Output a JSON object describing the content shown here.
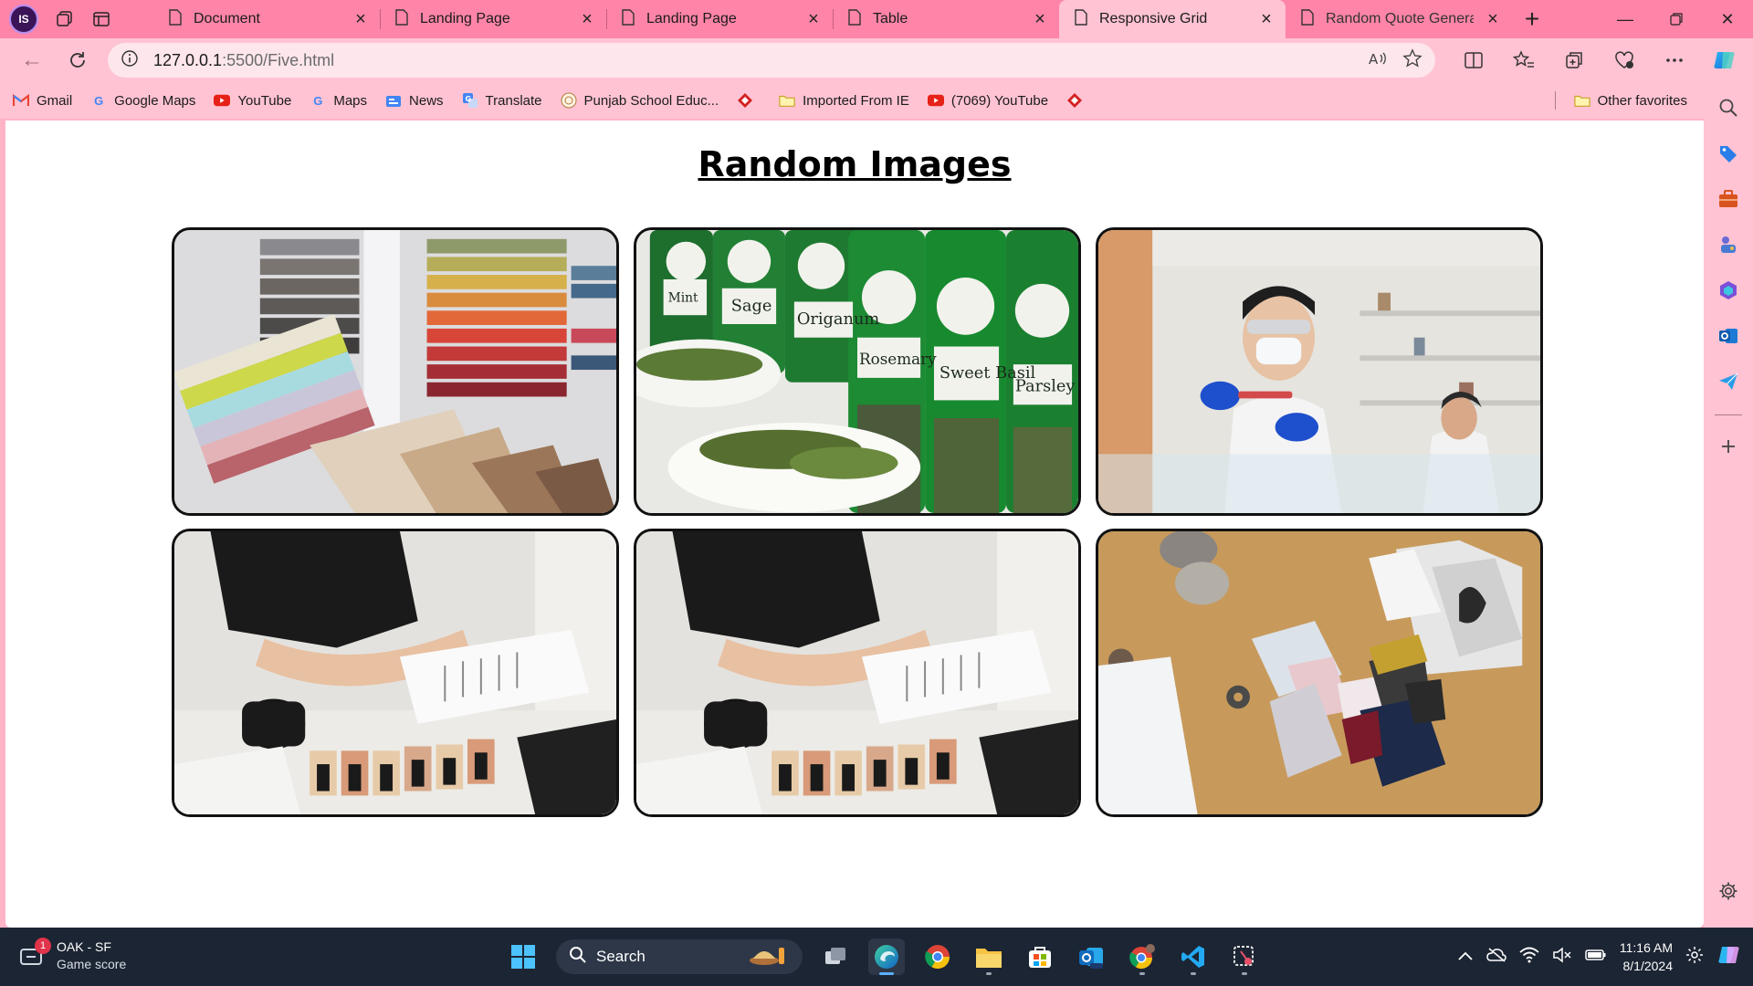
{
  "browser": {
    "profile_initials": "IS",
    "tabs": [
      {
        "title": "Document",
        "active": false
      },
      {
        "title": "Landing Page",
        "active": false
      },
      {
        "title": "Landing Page",
        "active": false
      },
      {
        "title": "Table",
        "active": false
      },
      {
        "title": "Responsive Grid",
        "active": true
      },
      {
        "title": "Random Quote Generato",
        "active": false
      }
    ],
    "address": {
      "host": "127.0.0.1",
      "rest": ":5500/Five.html"
    },
    "bookmarks": [
      {
        "label": "Gmail",
        "icon": "gmail-icon"
      },
      {
        "label": "Google Maps",
        "icon": "google-icon"
      },
      {
        "label": "YouTube",
        "icon": "youtube-icon"
      },
      {
        "label": "Maps",
        "icon": "google-icon"
      },
      {
        "label": "News",
        "icon": "news-icon"
      },
      {
        "label": "Translate",
        "icon": "translate-icon"
      },
      {
        "label": "Punjab School Educ...",
        "icon": "school-icon"
      },
      {
        "label": "",
        "icon": "diamond-icon"
      },
      {
        "label": "Imported From IE",
        "icon": "folder-icon"
      },
      {
        "label": "(7069) YouTube",
        "icon": "youtube-icon"
      },
      {
        "label": "",
        "icon": "diamond-icon"
      }
    ],
    "other_favorites": "Other favorites"
  },
  "page": {
    "title": "Random Images",
    "images": [
      {
        "subject": "fabric and color swatches",
        "icon": "swatches-image"
      },
      {
        "subject": "spice jars with herbs",
        "icon": "spices-image",
        "jar_labels": [
          "Mint",
          "Sage",
          "Origanum",
          "Rosemary",
          "Sweet Basil",
          "Parsley"
        ]
      },
      {
        "subject": "scientist in lab",
        "icon": "lab-image"
      },
      {
        "subject": "person sketching fashion designs",
        "icon": "sketch-image"
      },
      {
        "subject": "person sketching fashion designs",
        "icon": "sketch-image"
      },
      {
        "subject": "fabric samples and photos on table",
        "icon": "fabrics-image"
      }
    ]
  },
  "taskbar": {
    "widget": {
      "line1": "OAK - SF",
      "line2": "Game score",
      "badge": "1"
    },
    "search_label": "Search",
    "clock": {
      "time": "11:16 AM",
      "date": "8/1/2024"
    }
  },
  "colors": {
    "tabstrip": "#ff85a8",
    "toolbar": "#ffc3d3",
    "taskbar": "#1c2533"
  }
}
